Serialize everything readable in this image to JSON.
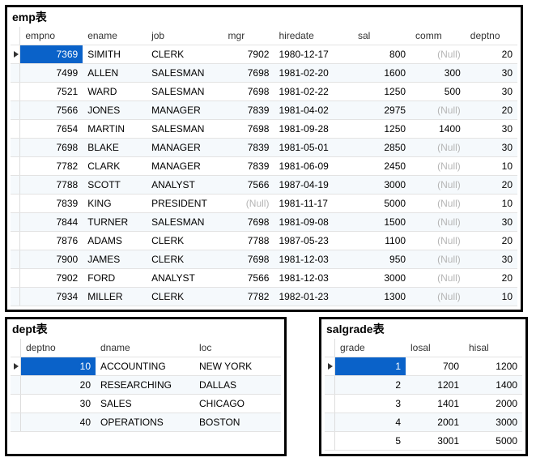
{
  "null_label": "(Null)",
  "emp": {
    "title": "emp表",
    "columns": [
      "empno",
      "ename",
      "job",
      "mgr",
      "hiredate",
      "sal",
      "comm",
      "deptno"
    ],
    "rows": [
      {
        "empno": 7369,
        "ename": "SIMITH",
        "job": "CLERK",
        "mgr": 7902,
        "hiredate": "1980-12-17",
        "sal": 800,
        "comm": null,
        "deptno": 20,
        "selected": true
      },
      {
        "empno": 7499,
        "ename": "ALLEN",
        "job": "SALESMAN",
        "mgr": 7698,
        "hiredate": "1981-02-20",
        "sal": 1600,
        "comm": 300,
        "deptno": 30
      },
      {
        "empno": 7521,
        "ename": "WARD",
        "job": "SALESMAN",
        "mgr": 7698,
        "hiredate": "1981-02-22",
        "sal": 1250,
        "comm": 500,
        "deptno": 30
      },
      {
        "empno": 7566,
        "ename": "JONES",
        "job": "MANAGER",
        "mgr": 7839,
        "hiredate": "1981-04-02",
        "sal": 2975,
        "comm": null,
        "deptno": 20
      },
      {
        "empno": 7654,
        "ename": "MARTIN",
        "job": "SALESMAN",
        "mgr": 7698,
        "hiredate": "1981-09-28",
        "sal": 1250,
        "comm": 1400,
        "deptno": 30
      },
      {
        "empno": 7698,
        "ename": "BLAKE",
        "job": "MANAGER",
        "mgr": 7839,
        "hiredate": "1981-05-01",
        "sal": 2850,
        "comm": null,
        "deptno": 30
      },
      {
        "empno": 7782,
        "ename": "CLARK",
        "job": "MANAGER",
        "mgr": 7839,
        "hiredate": "1981-06-09",
        "sal": 2450,
        "comm": null,
        "deptno": 10
      },
      {
        "empno": 7788,
        "ename": "SCOTT",
        "job": "ANALYST",
        "mgr": 7566,
        "hiredate": "1987-04-19",
        "sal": 3000,
        "comm": null,
        "deptno": 20
      },
      {
        "empno": 7839,
        "ename": "KING",
        "job": "PRESIDENT",
        "mgr": null,
        "hiredate": "1981-11-17",
        "sal": 5000,
        "comm": null,
        "deptno": 10
      },
      {
        "empno": 7844,
        "ename": "TURNER",
        "job": "SALESMAN",
        "mgr": 7698,
        "hiredate": "1981-09-08",
        "sal": 1500,
        "comm": null,
        "deptno": 30
      },
      {
        "empno": 7876,
        "ename": "ADAMS",
        "job": "CLERK",
        "mgr": 7788,
        "hiredate": "1987-05-23",
        "sal": 1100,
        "comm": null,
        "deptno": 20
      },
      {
        "empno": 7900,
        "ename": "JAMES",
        "job": "CLERK",
        "mgr": 7698,
        "hiredate": "1981-12-03",
        "sal": 950,
        "comm": null,
        "deptno": 30
      },
      {
        "empno": 7902,
        "ename": "FORD",
        "job": "ANALYST",
        "mgr": 7566,
        "hiredate": "1981-12-03",
        "sal": 3000,
        "comm": null,
        "deptno": 20
      },
      {
        "empno": 7934,
        "ename": "MILLER",
        "job": "CLERK",
        "mgr": 7782,
        "hiredate": "1982-01-23",
        "sal": 1300,
        "comm": null,
        "deptno": 10
      }
    ],
    "numeric_cols": [
      "empno",
      "mgr",
      "sal",
      "comm",
      "deptno"
    ]
  },
  "dept": {
    "title": "dept表",
    "columns": [
      "deptno",
      "dname",
      "loc"
    ],
    "rows": [
      {
        "deptno": 10,
        "dname": "ACCOUNTING",
        "loc": "NEW YORK",
        "selected": true
      },
      {
        "deptno": 20,
        "dname": "RESEARCHING",
        "loc": "DALLAS"
      },
      {
        "deptno": 30,
        "dname": "SALES",
        "loc": "CHICAGO"
      },
      {
        "deptno": 40,
        "dname": "OPERATIONS",
        "loc": "BOSTON"
      }
    ],
    "numeric_cols": [
      "deptno"
    ]
  },
  "salgrade": {
    "title": "salgrade表",
    "columns": [
      "grade",
      "losal",
      "hisal"
    ],
    "rows": [
      {
        "grade": 1,
        "losal": 700,
        "hisal": 1200,
        "selected": true
      },
      {
        "grade": 2,
        "losal": 1201,
        "hisal": 1400
      },
      {
        "grade": 3,
        "losal": 1401,
        "hisal": 2000
      },
      {
        "grade": 4,
        "losal": 2001,
        "hisal": 3000
      },
      {
        "grade": 5,
        "losal": 3001,
        "hisal": 5000
      }
    ],
    "numeric_cols": [
      "grade",
      "losal",
      "hisal"
    ]
  },
  "col_widths": {
    "emp": {
      "empno": 70,
      "ename": 70,
      "job": 85,
      "mgr": 55,
      "hiredate": 90,
      "sal": 65,
      "comm": 60,
      "deptno": 55
    },
    "dept": {
      "deptno": 80,
      "dname": 110,
      "loc": 95
    },
    "salgrade": {
      "grade": 75,
      "losal": 60,
      "hisal": 60
    }
  }
}
